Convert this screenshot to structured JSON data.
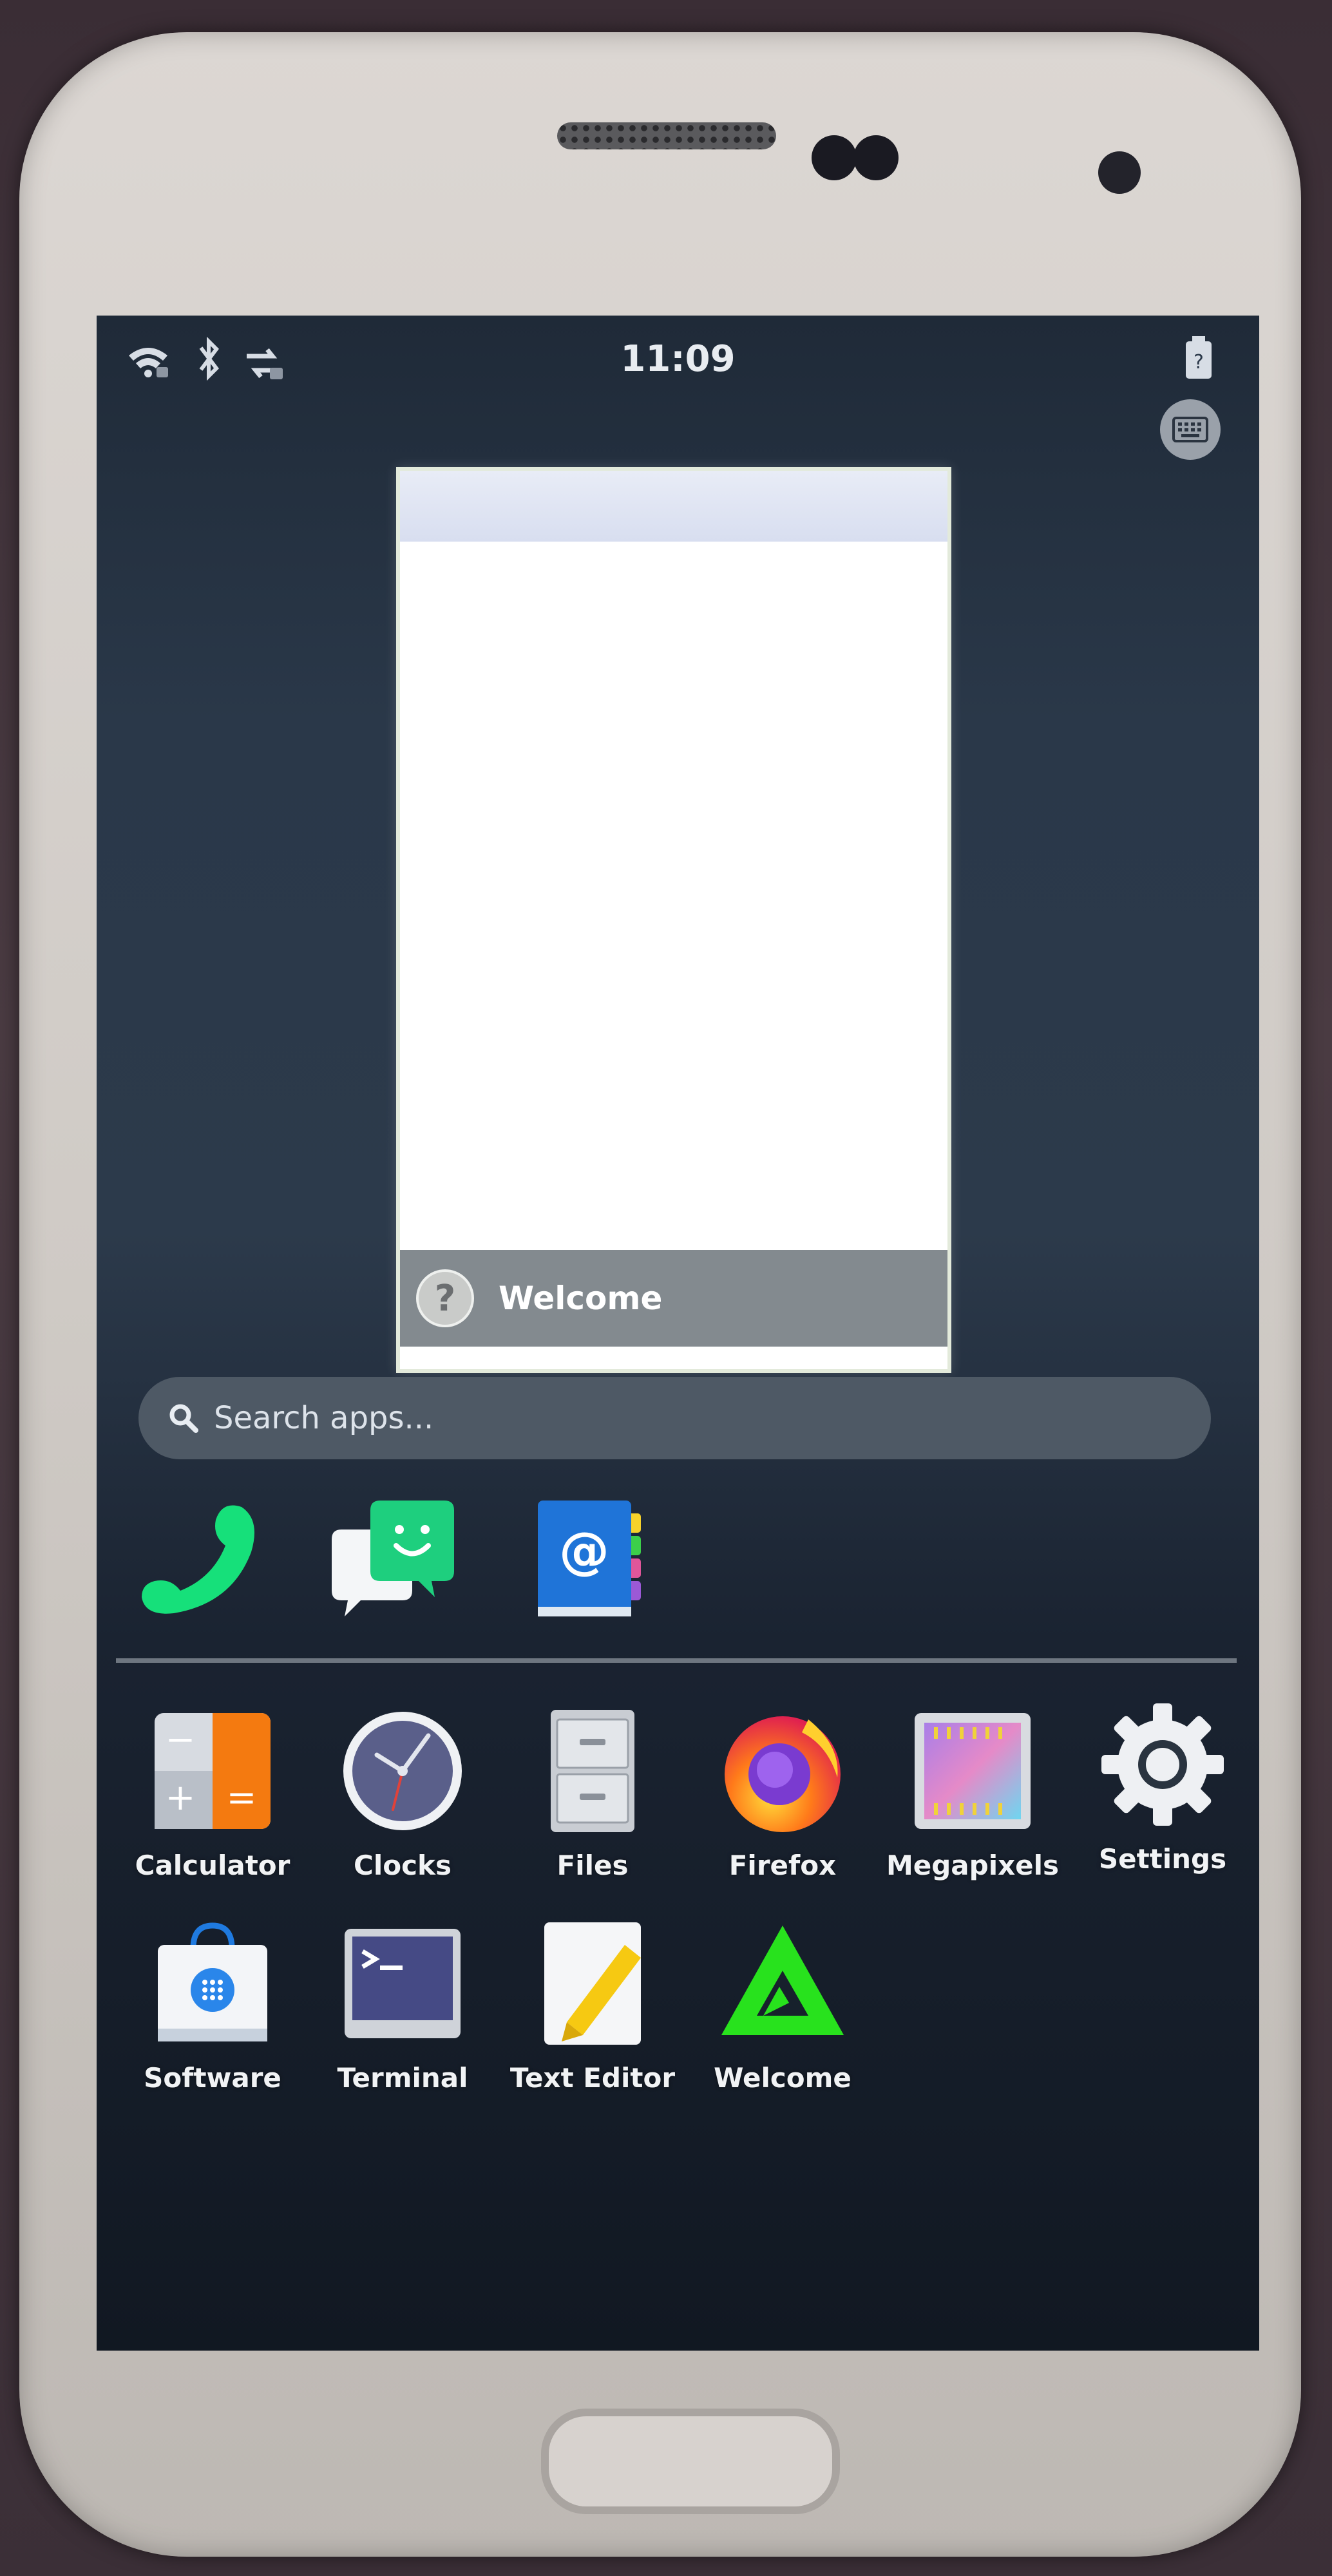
{
  "status_bar": {
    "time": "11:09",
    "icons": [
      "wifi-icon",
      "bluetooth-icon",
      "network-transfer-icon",
      "battery-icon"
    ]
  },
  "keyboard_toggle": {
    "icon": "keyboard-icon"
  },
  "open_app": {
    "title": "Welcome",
    "icon": "help-icon"
  },
  "search": {
    "placeholder": "Search apps..."
  },
  "favorites": [
    {
      "name": "phone",
      "icon": "phone-icon"
    },
    {
      "name": "chat",
      "icon": "chat-icon"
    },
    {
      "name": "contacts",
      "icon": "contacts-icon"
    }
  ],
  "apps": [
    {
      "label": "Calculator",
      "icon": "calculator-icon"
    },
    {
      "label": "Clocks",
      "icon": "clock-icon"
    },
    {
      "label": "Files",
      "icon": "file-cabinet-icon"
    },
    {
      "label": "Firefox",
      "icon": "firefox-icon"
    },
    {
      "label": "Megapixels",
      "icon": "camera-film-icon"
    },
    {
      "label": "Settings",
      "icon": "gear-icon"
    },
    {
      "label": "Software",
      "icon": "shopping-bag-icon"
    },
    {
      "label": "Terminal",
      "icon": "terminal-icon"
    },
    {
      "label": "Text Editor",
      "icon": "text-editor-icon"
    },
    {
      "label": "Welcome",
      "icon": "welcome-triangle-icon"
    }
  ],
  "colors": {
    "phone_green": "#16e07a",
    "chat_green": "#1ecf7e",
    "calculator_orange": "#f47a10",
    "firefox_orange": "#ff7a1a",
    "welcome_green": "#28e21d"
  }
}
